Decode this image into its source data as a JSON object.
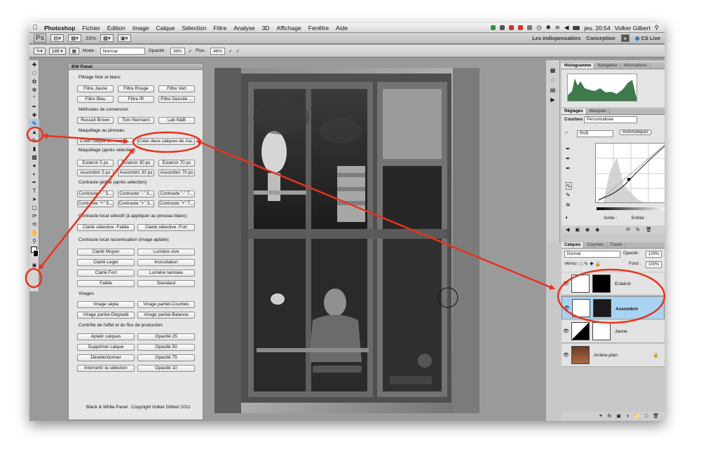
{
  "menubar": {
    "app": "Photoshop",
    "items": [
      "Fichier",
      "Edition",
      "Image",
      "Calque",
      "Sélection",
      "Filtre",
      "Analyse",
      "3D",
      "Affichage",
      "Fenêtre",
      "Aide"
    ],
    "clock": "jeu. 20:54",
    "user": "Volker Gilbert"
  },
  "appbar": {
    "logo": "Ps",
    "zoom": "33%",
    "workspace_1": "Les indispensables",
    "workspace_2": "Conception",
    "cs_live": "CS Live"
  },
  "options": {
    "brush_size": "189",
    "mode_label": "Mode :",
    "mode_value": "Normal",
    "opacity_label": "Opacité :",
    "opacity_value": "36%",
    "flow_label": "Flux :",
    "flow_value": "48%"
  },
  "bwpanel": {
    "title": "BW Panel",
    "sec_filtrage": "Filtrage Noir et blanc",
    "filtrage": [
      "Filtre Jaune",
      "Filtre Rouge",
      "Filtre Vert",
      "Filtre Bleu",
      "Filtre IR",
      "Filtre Densité ..."
    ],
    "sec_methodes": "Méthodes de conversion",
    "methodes": [
      "Russell Brown",
      "Tom Niemann",
      "Lab N&B"
    ],
    "sec_maquillage": "Maquillage au pinceau",
    "maquillage": [
      "Créer calque de maquil...",
      "Créer deux calques de ma..."
    ],
    "sec_apres": "Maquillage (après sélection)",
    "apres": [
      "Eclaircir 5 px",
      "Eclaircir 30 px",
      "Eclaircir 70 px",
      "Assombrir 5 px",
      "Assombrir 30 px",
      "Assombrir 70 px"
    ],
    "sec_contraste": "Contraste global (après sélection)",
    "contraste": [
      "Contraste \"-\" 5...",
      "Contraste \"-\" 3...",
      "Contraste \"-\" 7...",
      "Contraste \"+\" 5...",
      "Contraste \"+\" 3...",
      "Contraste \"+\" 7..."
    ],
    "sec_local": "Contraste local sélectif (à appliquer au pinceau blanc)",
    "local": [
      "Clarté sélective -Faible",
      "Clarté sélective -Fort"
    ],
    "sec_accentuation": "Contraste local /accentuation (image aplatie)",
    "accentuation": [
      "Clarté Moyen",
      "Lumière vive",
      "Clarté Leger",
      "Incrustation",
      "Clarté Fort",
      "Lumière tamisée",
      "Faible",
      "Standard"
    ],
    "sec_virages": "Virages",
    "virages": [
      "Virage sépia",
      "Virage partiel-Courbes",
      "Virage partiel-Dégradé",
      "Virage partiel-Balance"
    ],
    "sec_controle": "Contrôle de l'effet et du flux de production",
    "controle": [
      "Aplatir calques",
      "Opacité 25",
      "Supprimer calque",
      "Opacité 50",
      "Déselectionner",
      "Opacité 75",
      "Intervertir la sélection",
      "Opacité 10"
    ],
    "copyright": "Black & White Panel : Copyright Volker Gilbert 2011"
  },
  "histo": {
    "tabs": [
      "Histogramme",
      "Navigation",
      "Informations"
    ]
  },
  "adjust": {
    "tabs": [
      "Réglages",
      "Masques"
    ],
    "curves_label": "Courbes",
    "preset": "Personnalisée",
    "channel": "RVB",
    "auto": "Automatiques",
    "out_label": "Sortie :",
    "in_label": "Entrée :"
  },
  "layers": {
    "tabs": [
      "Calques",
      "Couches",
      "Tracés"
    ],
    "blend": "Normal",
    "opacity_label": "Opacité :",
    "opacity": "100%",
    "lock_label": "Verrou :",
    "fill_label": "Fond :",
    "fill": "100%",
    "items": [
      "Eclaircir",
      "Assombrir",
      "Jaune",
      "Arrière-plan"
    ]
  },
  "colors": {
    "annotation": "#e8321e",
    "selected_layer": "#a9d3f2",
    "histogram": "#3f7a4a"
  }
}
